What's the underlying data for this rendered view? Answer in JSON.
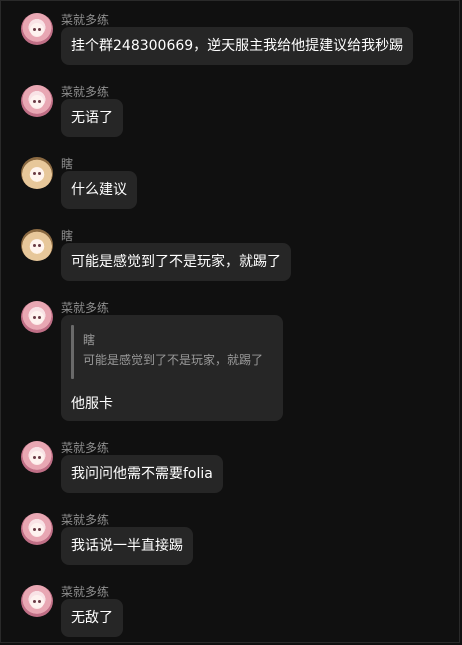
{
  "messages": [
    {
      "sender": "菜就多练",
      "text": "挂个群248300669，逆天服主我给他提建议给我秒踢"
    },
    {
      "sender": "菜就多练",
      "text": "无语了"
    },
    {
      "sender": "瞎",
      "text": "什么建议"
    },
    {
      "sender": "瞎",
      "text": "可能是感觉到了不是玩家，就踢了"
    },
    {
      "sender": "菜就多练",
      "quote": {
        "sender": "瞎",
        "text": "可能是感觉到了不是玩家，就踢了"
      },
      "text": "他服卡"
    },
    {
      "sender": "菜就多练",
      "text": "我问问他需不需要folia"
    },
    {
      "sender": "菜就多练",
      "text": "我话说一半直接踢"
    },
    {
      "sender": "菜就多练",
      "text": "无敌了"
    }
  ],
  "colors": {
    "background": "#101010",
    "bubble": "#262626",
    "name": "#8e8e8e",
    "text": "#ffffff"
  }
}
